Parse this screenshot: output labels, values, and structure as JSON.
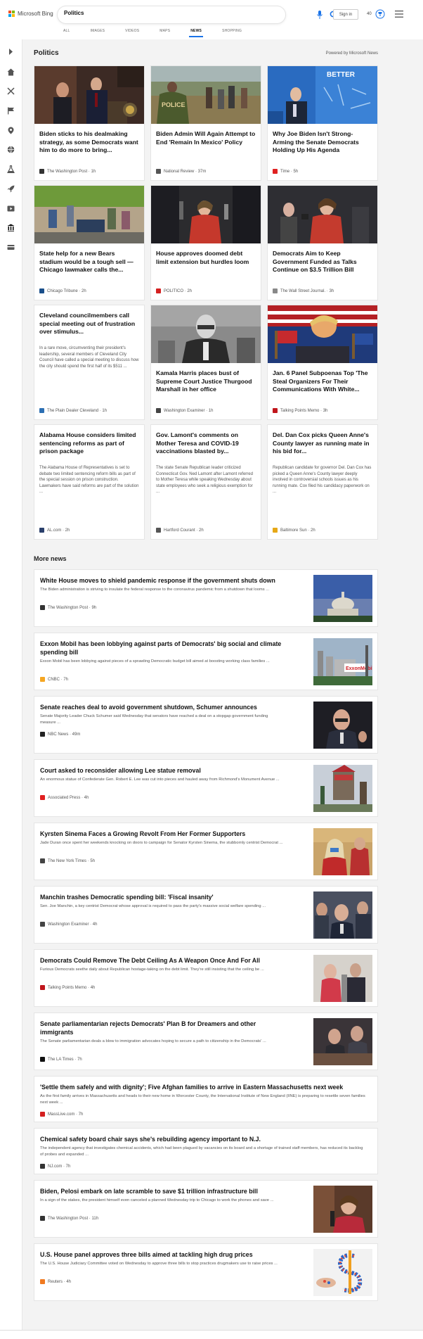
{
  "brand": {
    "name": "Microsoft Bing",
    "colors": [
      "#f25022",
      "#7fba00",
      "#00a4ef",
      "#ffb900"
    ]
  },
  "search": {
    "query": "Politics",
    "placeholder": ""
  },
  "header": {
    "signin_label": "Sign in",
    "rewards_count": "40"
  },
  "tabs": [
    {
      "label": "ALL",
      "active": false
    },
    {
      "label": "IMAGES",
      "active": false
    },
    {
      "label": "VIDEOS",
      "active": false
    },
    {
      "label": "MAPS",
      "active": false
    },
    {
      "label": "NEWS",
      "active": true
    },
    {
      "label": "SHOPPING",
      "active": false
    }
  ],
  "rail_icons": [
    "expand-icon",
    "home-icon",
    "sports-icon",
    "flag-icon",
    "location-icon",
    "globe-icon",
    "science-icon",
    "rocket-icon",
    "entertainment-icon",
    "government-icon",
    "money-icon"
  ],
  "section": {
    "title": "Politics",
    "powered_by": "Powered by Microsoft News"
  },
  "cards": [
    {
      "title": "Biden sticks to his dealmaking strategy, as some Democrats want him to do more to bring...",
      "source": "The Washington Post · 1h",
      "fav_color": "#333333"
    },
    {
      "title": "Biden Admin Will Again Attempt to End 'Remain In Mexico' Policy",
      "source": "National Review · 37m",
      "fav_color": "#555555"
    },
    {
      "title": "Why Joe Biden Isn't Strong-Arming the Senate Democrats Holding Up His Agenda",
      "source": "Time · 5h",
      "fav_color": "#e02020"
    },
    {
      "title": "State help for a new Bears stadium would be a tough sell — Chicago lawmaker calls the...",
      "source": "Chicago Tribune · 2h",
      "fav_color": "#1a4f8a"
    },
    {
      "title": "House approves doomed debt limit extension but hurdles loom",
      "source": "POLITICO · 2h",
      "fav_color": "#d42020"
    },
    {
      "title": "Democrats Aim to Keep Government Funded as Talks Continue on $3.5 Trillion Bill",
      "source": "The Wall Street Journal. · 3h",
      "fav_color": "#888888"
    },
    {
      "title": "Cleveland councilmembers call special meeting out of frustration over stimulus...",
      "desc": "In a rare move, circumventing their president's leadership, several members of Cleveland City Council have called a special meeting to discuss how the city should spend the first half of its $511 ...",
      "source": "The Plain Dealer Cleveland · 1h",
      "fav_color": "#2c6fb3"
    },
    {
      "title": "Kamala Harris places bust of Supreme Court Justice Thurgood Marshall in her office",
      "source": "Washington Examiner · 1h",
      "fav_color": "#444444"
    },
    {
      "title": "Jan. 6 Panel Subpoenas Top 'The Steal Organizers For Their Communications With White...",
      "source": "Talking Points Memo · 3h",
      "fav_color": "#c0161c"
    },
    {
      "title": "Alabama House considers limited sentencing reforms as part of prison package",
      "desc": "The Alabama House of Representatives is set to debate two limited sentencing reform bills as part of the special session on prison construction. Lawmakers have said reforms are part of the solution ...",
      "source": "AL.com · 2h",
      "fav_color": "#2a3f6b"
    },
    {
      "title": "Gov. Lamont's comments on Mother Teresa and COVID-19 vaccinations blasted by...",
      "desc": "The state Senate Republican leader criticized Connecticut Gov. Ned Lamont after Lamont referred to Mother Teresa while speaking Wednesday about state employees who seek a religious exemption for ...",
      "source": "Hartford Courant · 2h",
      "fav_color": "#555555"
    },
    {
      "title": "Del. Dan Cox picks Queen Anne's County lawyer as running mate in his bid for...",
      "desc": "Republican candidate for governor Del. Dan Cox has picked a Queen Anne's County lawyer deeply involved in controversial schools issues as his running mate. Cox filed his candidacy paperwork on ...",
      "source": "Baltimore Sun · 2h",
      "fav_color": "#e6a817"
    }
  ],
  "more_news": {
    "title": "More news",
    "items": [
      {
        "title": "White House moves to shield pandemic response if the government shuts down",
        "desc": "The Biden administration is striving to insulate the federal response to the coronavirus pandemic from a shutdown that looms ...",
        "source": "The Washington Post · 9h",
        "fav_color": "#333333"
      },
      {
        "title": "Exxon Mobil has been lobbying against parts of Democrats' big social and climate spending bill",
        "desc": "Exxon Mobil has been lobbying against pieces of a sprawling Democratic budget bill aimed at boosting working class families ...",
        "source": "CNBC · 7h",
        "fav_color": "#f5a623"
      },
      {
        "title": "Senate reaches deal to avoid government shutdown, Schumer announces",
        "desc": "Senate Majority Leader Chuck Schumer said Wednesday that senators have reached a deal on a stopgap government funding measure ...",
        "source": "NBC News · 49m",
        "fav_color": "#222222"
      },
      {
        "title": "Court asked to reconsider allowing Lee statue removal",
        "desc": "An enormous statue of Confederate Gen. Robert E. Lee was cut into pieces and hauled away from Richmond's Monument Avenue ...",
        "source": "Associated Press · 4h",
        "fav_color": "#e02020"
      },
      {
        "title": "Kyrsten Sinema Faces a Growing Revolt From Her Former Supporters",
        "desc": "Jade Duran once spent her weekends knocking on doors to campaign for Senator Kyrsten Sinema, the stubbornly centrist Democrat ...",
        "source": "The New York Times · 5h",
        "fav_color": "#444444"
      },
      {
        "title": "Manchin trashes Democratic spending bill: 'Fiscal insanity'",
        "desc": "Sen. Joe Manchin, a key centrist Democrat whose approval is required to pass the party's massive social welfare spending ...",
        "source": "Washington Examiner · 4h",
        "fav_color": "#444444"
      },
      {
        "title": "Democrats Could Remove The Debt Ceiling As A Weapon Once And For All",
        "desc": "Furious Democrats seethe daily about Republican hostage-taking on the debt limit. They're still insisting that the ceiling be ...",
        "source": "Talking Points Memo · 4h",
        "fav_color": "#c0161c"
      },
      {
        "title": "Senate parliamentarian rejects Democrats' Plan B for Dreamers and other immigrants",
        "desc": "The Senate parliamentarian deals a blow to immigration advocates hoping to secure a path to citizenship in the Democrats' ...",
        "source": "The LA Times · 7h",
        "fav_color": "#111111"
      },
      {
        "title": "'Settle them safely and with dignity'; Five Afghan families to arrive in Eastern Massachusetts next week",
        "desc": "As the first family arrives in Massachusetts and heads to their new home in Worcester County, the International Institute of New England (IINE) is preparing to resettle seven families next week ...",
        "source": "MassLive.com · 7h",
        "fav_color": "#d42020"
      },
      {
        "title": "Chemical safety board chair says she's rebuilding agency important to N.J.",
        "desc": "The independent agency that investigates chemical accidents, which had been plagued by vacancies on its board and a shortage of trained staff members, has reduced its backlog of probes and expanded ...",
        "source": "NJ.com · 7h",
        "fav_color": "#333333"
      },
      {
        "title": "Biden, Pelosi embark on late scramble to save $1 trillion infrastructure bill",
        "desc": "In a sign of the stakes, the president himself even canceled a planned Wednesday trip to Chicago to work the phones and save ...",
        "source": "The Washington Post · 11h",
        "fav_color": "#333333"
      },
      {
        "title": "U.S. House panel approves three bills aimed at tackling high drug prices",
        "desc": "The U.S. House Judiciary Committee voted on Wednesday to approve three bills to stop practices drugmakers use to raise prices ...",
        "source": "Reuters · 4h",
        "fav_color": "#f07a20"
      }
    ]
  }
}
